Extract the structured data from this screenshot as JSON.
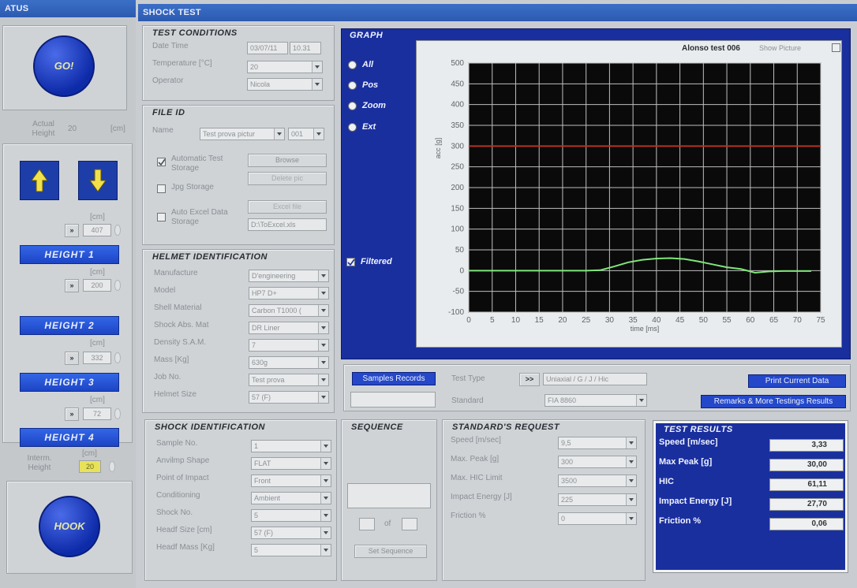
{
  "status": {
    "title": "ATUS",
    "go_label": "GO!",
    "actual_height_label": "Actual Height",
    "actual_height_value": "20",
    "cm_unit": "[cm]",
    "height_slots": [
      {
        "unit": "[cm]",
        "value": "407",
        "label": "HEIGHT 1"
      },
      {
        "unit": "[cm]",
        "value": "200",
        "label": "HEIGHT 2"
      },
      {
        "unit": "[cm]",
        "value": "332",
        "label": "HEIGHT 3"
      },
      {
        "unit": "[cm]",
        "value": "72",
        "label": "HEIGHT 4"
      }
    ],
    "interm_height_label": "Interm. Height",
    "interm_unit": "[cm]",
    "interm_value": "20",
    "hook_label": "HOOK",
    "slot_button": "»"
  },
  "main": {
    "title": "SHOCK TEST"
  },
  "test_conditions": {
    "title": "TEST CONDITIONS",
    "date_time_label": "Date   Time",
    "date_value": "03/07/11",
    "time_value": "10.31",
    "temperature_label": "Temperature [°C]",
    "temperature_value": "20",
    "operator_label": "Operator",
    "operator_value": "Nicola"
  },
  "file_id": {
    "title": "FILE ID",
    "name_label": "Name",
    "name_value": "Test prova pictur",
    "name_index": "001",
    "auto_test_label": "Automatic Test Storage",
    "browse_label": "Browse",
    "jpg_label": "Jpg Storage",
    "jpg_button": "Delete pic",
    "auto_excel_label": "Auto Excel Data Storage",
    "excel_button": "Excel file",
    "excel_path": "D:\\ToExcel.xls"
  },
  "helmet": {
    "title": "HELMET IDENTIFICATION",
    "rows": [
      {
        "label": "Manufacture",
        "value": "D'engineering"
      },
      {
        "label": "Model",
        "value": "HP7 D+"
      },
      {
        "label": "Shell Material",
        "value": "Carbon T1000 ("
      },
      {
        "label": "Shock Abs. Mat",
        "value": "DR Liner"
      },
      {
        "label": "Density S.A.M.",
        "value": "7"
      },
      {
        "label": "Mass [Kg]",
        "value": "630g"
      },
      {
        "label": "Job No.",
        "value": "Test prova"
      },
      {
        "label": "Helmet Size",
        "value": "57 (F)"
      }
    ]
  },
  "shock_id": {
    "title": "SHOCK IDENTIFICATION",
    "rows": [
      {
        "label": "Sample No.",
        "value": "1"
      },
      {
        "label": "Anvilmp Shape",
        "value": "FLAT"
      },
      {
        "label": "Point of Impact",
        "value": "Front"
      },
      {
        "label": "Conditioning",
        "value": "Ambient"
      },
      {
        "label": "Shock No.",
        "value": "5"
      },
      {
        "label": "Headf Size [cm]",
        "value": "57 (F)"
      },
      {
        "label": "Headf Mass [Kg]",
        "value": "5"
      }
    ]
  },
  "sequence": {
    "title": "SEQUENCE",
    "of_label": "of",
    "set_button": "Set Sequence"
  },
  "standard_request": {
    "title": "STANDARD'S REQUEST",
    "rows": [
      {
        "label": "Speed [m/sec]",
        "value": "9,5"
      },
      {
        "label": "Max. Peak [g]",
        "value": "300"
      },
      {
        "label": "Max. HIC Limit",
        "value": "3500"
      },
      {
        "label": "Impact Energy [J]",
        "value": "225"
      },
      {
        "label": "Friction %",
        "value": "0"
      }
    ]
  },
  "test_results": {
    "title": "TEST RESULTS",
    "rows": [
      {
        "label": "Speed [m/sec]",
        "value": "3,33"
      },
      {
        "label": "Max Peak [g]",
        "value": "30,00"
      },
      {
        "label": "HIC",
        "value": "61,11"
      },
      {
        "label": "Impact Energy [J]",
        "value": "27,70"
      },
      {
        "label": "Friction %",
        "value": "0,06"
      }
    ]
  },
  "graph": {
    "title": "GRAPH",
    "radios": [
      "All",
      "Pos",
      "Zoom",
      "Ext"
    ],
    "filtered_label": "Filtered",
    "header_name": "Alonso test 006",
    "show_picture": "Show Picture"
  },
  "bottom_bar": {
    "samples_button": "Samples Records",
    "test_type_label": "Test Type",
    "nav_button": ">>",
    "test_type_value": "Uniaxial / G / J / Hic",
    "standard_label": "Standard",
    "standard_value": "FIA 8860",
    "print_button": "Print Current Data",
    "remarks_button": "Remarks & More Testings Results"
  },
  "chart_data": {
    "type": "line",
    "xlabel": "time [ms]",
    "ylabel": "acc [g]",
    "xlim": [
      0,
      75
    ],
    "ylim": [
      -100,
      500
    ],
    "x_ticks": [
      0,
      5,
      10,
      15,
      20,
      25,
      30,
      35,
      40,
      45,
      50,
      55,
      60,
      65,
      70,
      75
    ],
    "y_ticks": [
      500,
      450,
      400,
      350,
      300,
      250,
      200,
      150,
      100,
      50,
      0,
      -50,
      -100
    ],
    "grid": true,
    "threshold": {
      "value": 300,
      "color": "#b8321f"
    },
    "series": [
      {
        "color": "#7fe67a",
        "x": [
          0,
          5,
          10,
          15,
          20,
          25,
          28,
          31,
          34,
          37,
          40,
          43,
          46,
          49,
          52,
          55,
          58,
          61,
          64,
          67,
          70,
          73
        ],
        "y": [
          0,
          0,
          0,
          0,
          0,
          0,
          1,
          10,
          20,
          26,
          29,
          30,
          28,
          22,
          15,
          8,
          4,
          -5,
          -2,
          -1,
          -1,
          -1
        ]
      }
    ]
  }
}
